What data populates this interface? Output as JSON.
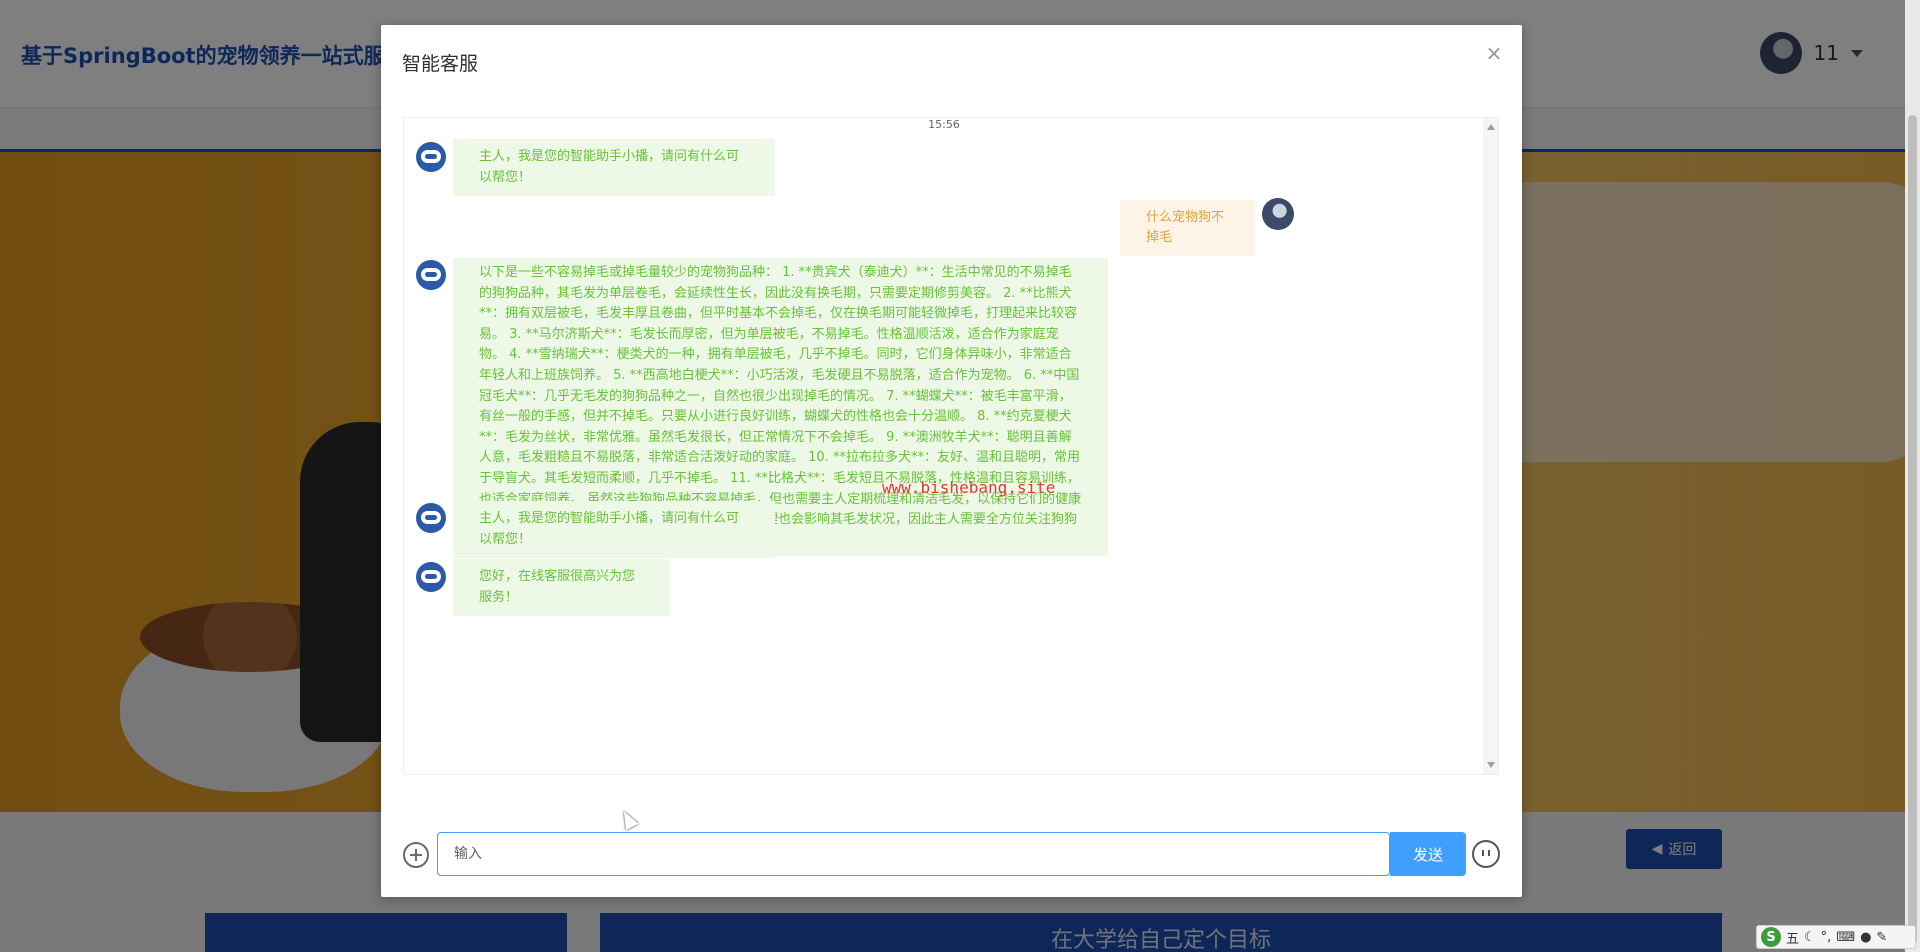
{
  "header": {
    "site_title": "基于SpringBoot的宠物领养一站式服",
    "user_name": "11"
  },
  "page": {
    "back_label": "返回",
    "banner_text": "在大学给自己定个目标"
  },
  "dialog": {
    "title": "智能客服",
    "close_icon": "close-icon",
    "time": "15:56",
    "messages": [
      {
        "from": "bot",
        "text": "主人，我是您的智能助手小播，请问有什么可以帮您！"
      },
      {
        "from": "user",
        "text": "什么宠物狗不掉毛"
      },
      {
        "from": "bot",
        "text": "以下是一些不容易掉毛或掉毛量较少的宠物狗品种： 1. **贵宾犬（泰迪犬）**：生活中常见的不易掉毛的狗狗品种，其毛发为单层卷毛，会延续性生长，因此没有换毛期，只需要定期修剪美容。 2. **比熊犬**：拥有双层被毛，毛发丰厚且卷曲，但平时基本不会掉毛，仅在换毛期可能轻微掉毛，打理起来比较容易。 3. **马尔济斯犬**：毛发长而厚密，但为单层被毛，不易掉毛。性格温顺活泼，适合作为家庭宠物。 4. **雪纳瑞犬**：梗类犬的一种，拥有单层被毛，几乎不掉毛。同时，它们身体异味小，非常适合年轻人和上班族饲养。 5. **西高地白梗犬**：小巧活泼，毛发硬且不易脱落，适合作为宠物。 6. **中国冠毛犬**：几乎无毛发的狗狗品种之一，自然也很少出现掉毛的情况。 7. **蝴蝶犬**：被毛丰富平滑，有丝一般的手感，但并不掉毛。只要从小进行良好训练，蝴蝶犬的性格也会十分温顺。 8. **约克夏梗犬**：毛发为丝状，非常优雅。虽然毛发很长，但正常情况下不会掉毛。 9. **澳洲牧羊犬**：聪明且善解人意，毛发粗糙且不易脱落，非常适合活泼好动的家庭。 10. **拉布拉多犬**：友好、温和且聪明，常用于导盲犬。其毛发短而柔顺，几乎不掉毛。 11. **比格犬**：毛发短且不易脱落，性格温和且容易训练，也适合家庭饲养。 虽然这些狗狗品种不容易掉毛，但也需要主人定期梳理和清洁毛发，以保持它们的健康和美观。同时，狗狗的饮食、生活环境以及日常护理也会影响其毛发状况，因此主人需要全方位关注狗狗的健康状况。"
      },
      {
        "from": "bot",
        "text": "主人，我是您的智能助手小播，请问有什么可以帮您！"
      },
      {
        "from": "bot",
        "text": "您好，在线客服很高兴为您服务！"
      }
    ],
    "watermark": "www.bishebang.site",
    "input_placeholder": "输入",
    "send_label": "发送"
  },
  "ime": {
    "logo": "S",
    "mode": "五"
  },
  "colors": {
    "brand_blue": "#1d4fb0",
    "primary": "#409eff",
    "bot_text": "#67c23a",
    "bot_bg": "#eef8e6",
    "user_text": "#e6a23c",
    "user_bg": "#fdf3e6"
  }
}
